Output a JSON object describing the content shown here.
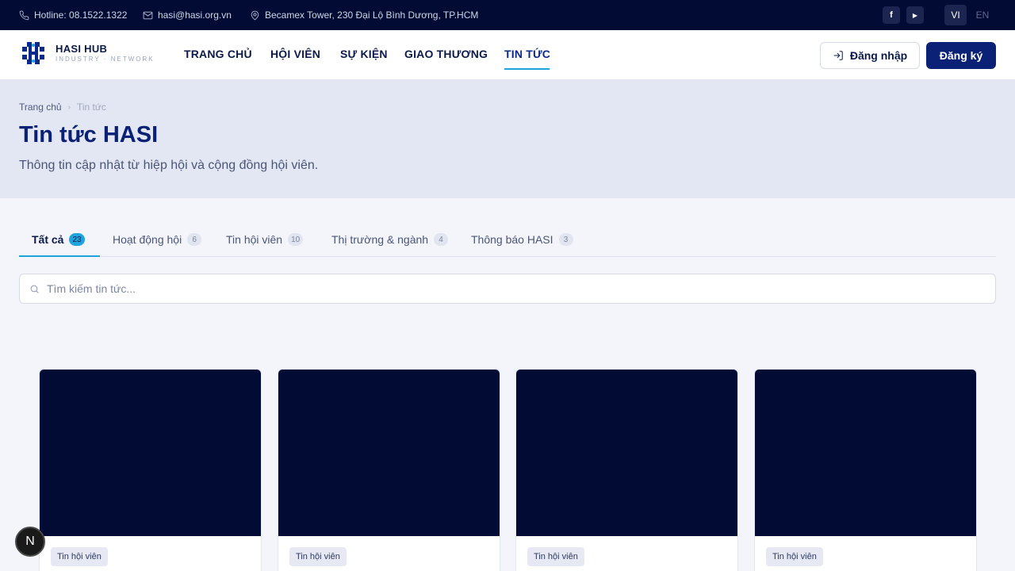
{
  "topbar": {
    "hotline": "Hotline: 08.1522.1322",
    "email": "hasi@hasi.org.vn",
    "address": "Becamex Tower, 230 Đại Lộ Bình Dương, TP.HCM",
    "social": [
      {
        "icon": "facebook-icon",
        "glyph": "f"
      },
      {
        "icon": "youtube-icon",
        "glyph": "▶"
      }
    ],
    "languages": [
      {
        "label": "VI",
        "active": true
      },
      {
        "label": "EN",
        "active": false
      }
    ]
  },
  "header": {
    "brand": "HASI HUB",
    "brand_sub": "INDUSTRY · NETWORK",
    "nav": [
      {
        "label": "TRANG CHỦ",
        "active": false
      },
      {
        "label": "HỘI VIÊN",
        "active": false
      },
      {
        "label": "SỰ KIỆN",
        "active": false
      },
      {
        "label": "GIAO THƯƠNG",
        "active": false
      },
      {
        "label": "TIN TỨC",
        "active": true
      }
    ],
    "login_label": "Đăng nhập",
    "register_label": "Đăng ký"
  },
  "hero": {
    "breadcrumb": [
      "Trang chủ",
      "Tin tức"
    ],
    "title": "Tin tức HASI",
    "subtitle": "Thông tin cập nhật từ hiệp hội và cộng đồng hội viên."
  },
  "tabs": [
    {
      "label": "Tất cả",
      "count": "23",
      "active": true
    },
    {
      "label": "Hoạt động hội",
      "count": "6",
      "active": false
    },
    {
      "label": "Tin hội viên",
      "count": "10",
      "active": false
    },
    {
      "label": "Thị trường & ngành",
      "count": "4",
      "active": false
    },
    {
      "label": "Thông báo HASI",
      "count": "3",
      "active": false
    }
  ],
  "search": {
    "placeholder": "Tìm kiếm tin tức..."
  },
  "cards": [
    {
      "tag": "Tin hội viên"
    },
    {
      "tag": "Tin hội viên"
    },
    {
      "tag": "Tin hội viên"
    },
    {
      "tag": "Tin hội viên"
    }
  ],
  "fab": {
    "label": "N"
  }
}
